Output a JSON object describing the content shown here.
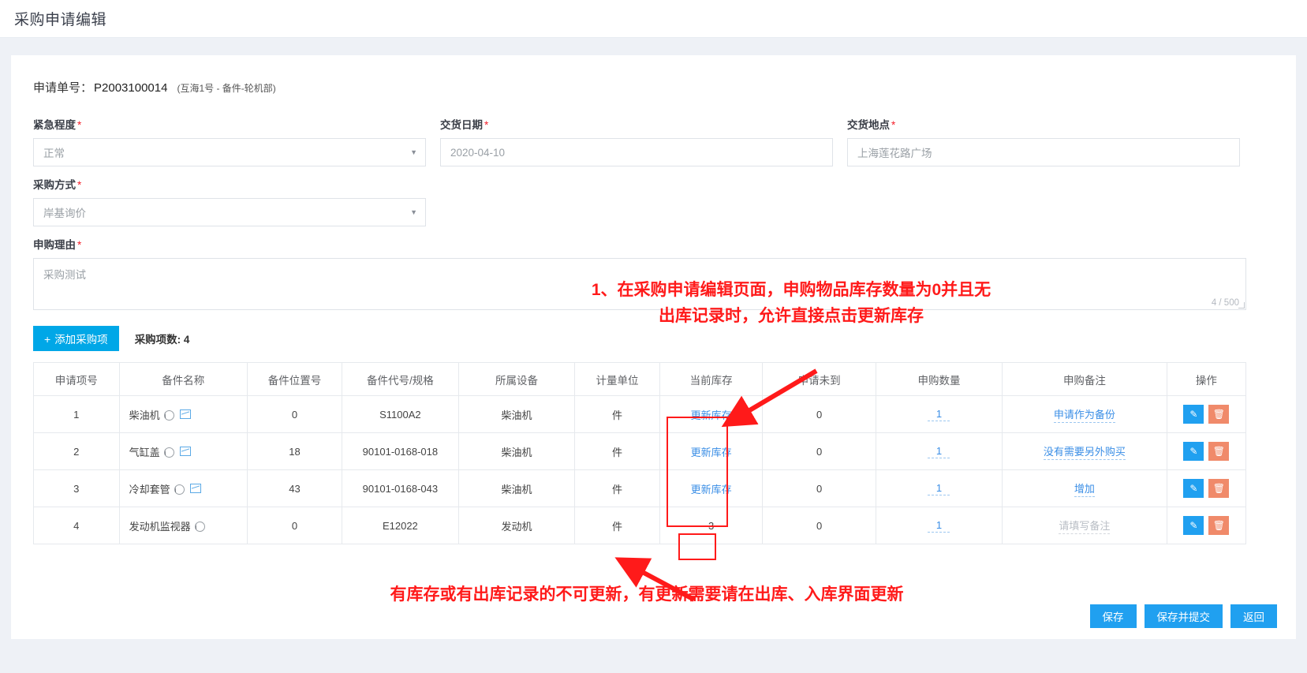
{
  "header": {
    "title": "采购申请编辑"
  },
  "application": {
    "label": "申请单号：",
    "number": "P2003100014",
    "subtitle": "(互海1号 - 备件-轮机部)"
  },
  "form": {
    "urgency": {
      "label": "紧急程度",
      "required": "*",
      "value": "正常",
      "caret": "chevron-down-icon"
    },
    "delivery_date": {
      "label": "交货日期",
      "required": "*",
      "value": "2020-04-10"
    },
    "delivery_place": {
      "label": "交货地点",
      "required": "*",
      "value": "上海莲花路广场"
    },
    "purchase_method": {
      "label": "采购方式",
      "required": "*",
      "value": "岸基询价",
      "caret": "chevron-down-icon"
    },
    "reason": {
      "label": "申购理由",
      "required": "*",
      "value": "采购测试",
      "counter": "4 / 500"
    }
  },
  "toolbar": {
    "add_label": "添加采购项",
    "add_icon": "plus-icon",
    "count_label": "采购项数: 4"
  },
  "table": {
    "columns": [
      "申请项号",
      "备件名称",
      "备件位置号",
      "备件代号/规格",
      "所属设备",
      "计量单位",
      "当前库存",
      "申请未到",
      "申购数量",
      "申购备注",
      "操作"
    ],
    "rows": [
      {
        "index": "1",
        "name": "柴油机",
        "position": "0",
        "code": "S1100A2",
        "equipment": "柴油机",
        "unit": "件",
        "stock": "更新库存",
        "stock_is_link": true,
        "not_arrived": "0",
        "qty": "1",
        "remark": "申请作为备份",
        "remark_placeholder": false
      },
      {
        "index": "2",
        "name": "气缸盖",
        "position": "18",
        "code": "90101-0168-018",
        "equipment": "柴油机",
        "unit": "件",
        "stock": "更新库存",
        "stock_is_link": true,
        "not_arrived": "0",
        "qty": "1",
        "remark": "没有需要另外购买",
        "remark_placeholder": false
      },
      {
        "index": "3",
        "name": "冷却套管",
        "position": "43",
        "code": "90101-0168-043",
        "equipment": "柴油机",
        "unit": "件",
        "stock": "更新库存",
        "stock_is_link": true,
        "not_arrived": "0",
        "qty": "1",
        "remark": "增加",
        "remark_placeholder": false
      },
      {
        "index": "4",
        "name": "发动机监视器",
        "position": "0",
        "code": "E12022",
        "equipment": "发动机",
        "unit": "件",
        "stock": "3",
        "stock_is_link": false,
        "not_arrived": "0",
        "qty": "1",
        "remark": "请填写备注",
        "remark_placeholder": true
      }
    ],
    "row_icons": {
      "info": "info-icon",
      "image": "image-icon"
    },
    "action_icons": {
      "edit": "pencil-icon",
      "delete": "trash-icon"
    }
  },
  "annotations": {
    "top": "1、在采购申请编辑页面，申购物品库存数量为0并且无\n出库记录时，允许直接点击更新库存",
    "bottom": "有库存或有出库记录的不可更新，有更新需要请在出库、入库界面更新",
    "color": "#ff1a1a"
  },
  "footer": {
    "save": "保存",
    "save_submit": "保存并提交",
    "back": "返回"
  },
  "colors": {
    "primary": "#00a7e7",
    "link": "#3a8ee6",
    "danger": "#f5222d",
    "annotation": "#ff1a1a"
  }
}
